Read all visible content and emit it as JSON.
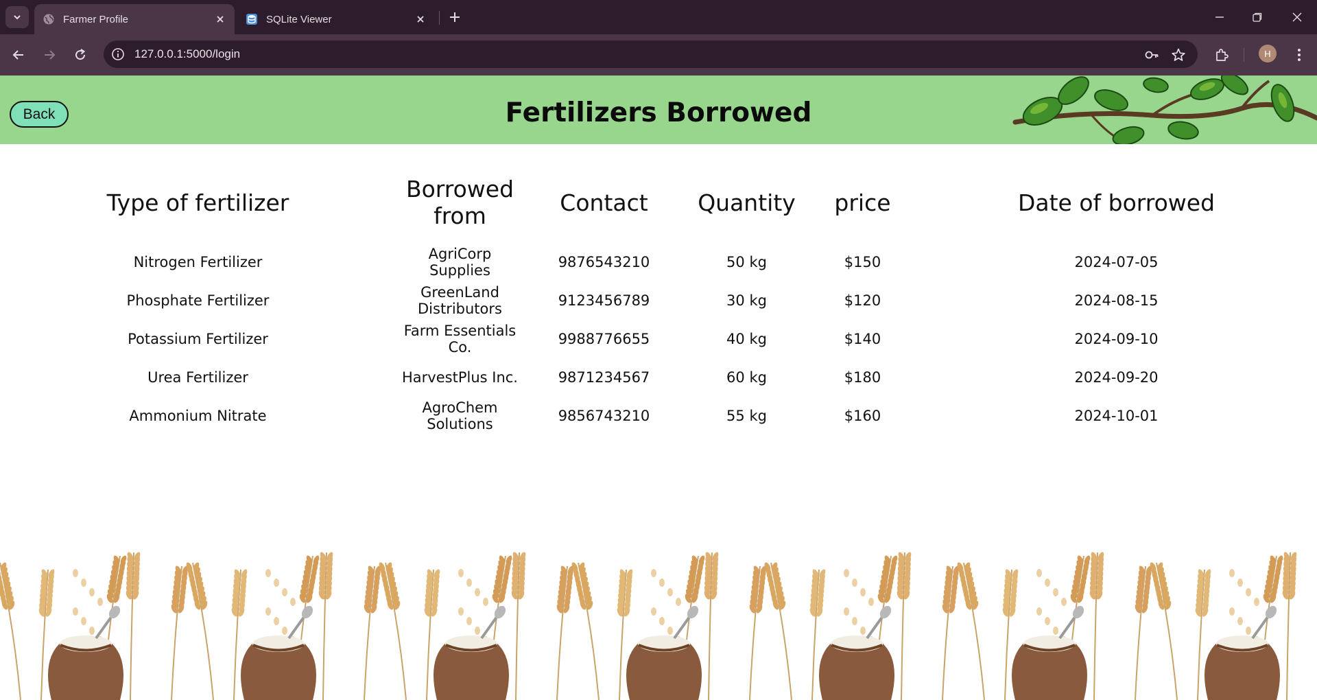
{
  "browser": {
    "tabs": [
      {
        "title": "Farmer Profile",
        "active": true,
        "icon": "globe-icon"
      },
      {
        "title": "SQLite Viewer",
        "active": false,
        "icon": "database-icon"
      }
    ],
    "url": "127.0.0.1:5000/login",
    "profile_initial": "H"
  },
  "header": {
    "back_label": "Back",
    "title": "Fertilizers Borrowed",
    "bg_color": "#98d68e"
  },
  "table": {
    "columns": [
      "Type of fertilizer",
      "Borrowed from",
      "Contact",
      "Quantity",
      "price",
      "Date of borrowed"
    ],
    "rows": [
      [
        "Nitrogen Fertilizer",
        "AgriCorp Supplies",
        "9876543210",
        "50 kg",
        "$150",
        "2024-07-05"
      ],
      [
        "Phosphate Fertilizer",
        "GreenLand Distributors",
        "9123456789",
        "30 kg",
        "$120",
        "2024-08-15"
      ],
      [
        "Potassium Fertilizer",
        "Farm Essentials Co.",
        "9988776655",
        "40 kg",
        "$140",
        "2024-09-10"
      ],
      [
        "Urea Fertilizer",
        "HarvestPlus Inc.",
        "9871234567",
        "60 kg",
        "$180",
        "2024-09-20"
      ],
      [
        "Ammonium Nitrate",
        "AgroChem Solutions",
        "9856743210",
        "55 kg",
        "$160",
        "2024-10-01"
      ]
    ]
  }
}
